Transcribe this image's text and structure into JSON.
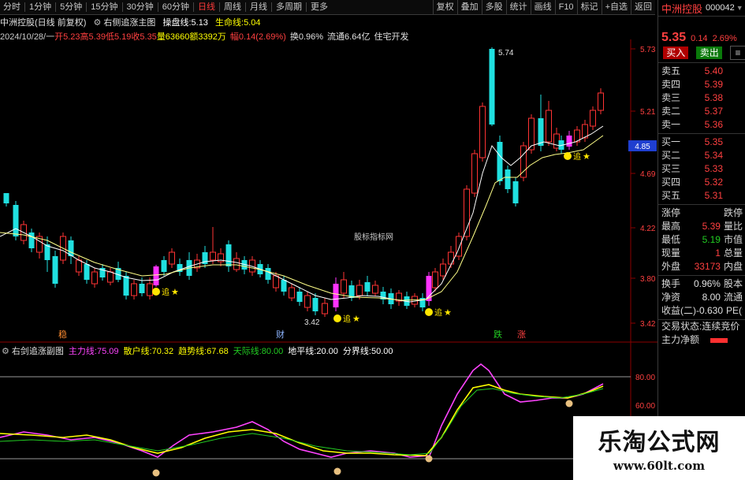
{
  "tabs": [
    {
      "label": "分时",
      "active": false
    },
    {
      "label": "1分钟",
      "active": false
    },
    {
      "label": "5分钟",
      "active": false
    },
    {
      "label": "15分钟",
      "active": false
    },
    {
      "label": "30分钟",
      "active": false
    },
    {
      "label": "60分钟",
      "active": false
    },
    {
      "label": "日线",
      "active": true
    },
    {
      "label": "周线",
      "active": false
    },
    {
      "label": "月线",
      "active": false
    },
    {
      "label": "多周期",
      "active": false
    },
    {
      "label": "更多",
      "active": false
    }
  ],
  "toolbar": [
    "复权",
    "叠加",
    "多股",
    "统计",
    "画线",
    "F10",
    "标记",
    "+自选",
    "返回"
  ],
  "info1": {
    "title": "中洲控股(日线 前复权)",
    "indicator": "右侧追涨主图",
    "pan_label": "操盘线:",
    "pan_value": "5.13",
    "life_label": "生命线:",
    "life_value": "5.04"
  },
  "info2": {
    "date": "2024/10/28/一",
    "open": "开5.23",
    "high": "高5.39",
    "low": "低5.19",
    "close": "收5.35",
    "vol": "量63660",
    "amount": "额3392万",
    "change": "幅0.14(2.69%)",
    "turnover": "换0.96%",
    "float": "流通6.64亿",
    "industry": "住宅开发"
  },
  "price_axis": [
    "5.73",
    "5.21",
    "4.69",
    "4.22",
    "3.80",
    "3.42"
  ],
  "current_price_tag": "4.85",
  "chart_center_label": "股标指标网",
  "peak_label": "5.74",
  "low_label": "3.42",
  "signal_text": "追",
  "period_markers": [
    "稳",
    "财",
    "跌",
    "涨"
  ],
  "lower_indicator": {
    "name": "右剑追涨副图",
    "lines": [
      {
        "label": "主力线:",
        "value": "75.09",
        "color": "#ff44ff"
      },
      {
        "label": "散户线:",
        "value": "70.32",
        "color": "#ffff00"
      },
      {
        "label": "趋势线:",
        "value": "67.68",
        "color": "#ffff00"
      },
      {
        "label": "天际线:",
        "value": "80.00",
        "color": "#22cc22"
      },
      {
        "label": "地平线:",
        "value": "20.00",
        "color": "#ffffff"
      },
      {
        "label": "分界线:",
        "value": "50.00",
        "color": "#ffffff"
      }
    ],
    "axis": [
      "80.00",
      "60.00"
    ]
  },
  "quote": {
    "name": "中洲控股",
    "code": "000042",
    "price": "5.35",
    "change": "0.14",
    "pct": "2.69%",
    "buy_btn": "买入",
    "sell_btn": "卖出",
    "asks": [
      {
        "label": "卖五",
        "price": "5.40"
      },
      {
        "label": "卖四",
        "price": "5.39"
      },
      {
        "label": "卖三",
        "price": "5.38"
      },
      {
        "label": "卖二",
        "price": "5.37"
      },
      {
        "label": "卖一",
        "price": "5.36"
      }
    ],
    "bids": [
      {
        "label": "买一",
        "price": "5.35"
      },
      {
        "label": "买二",
        "price": "5.34"
      },
      {
        "label": "买三",
        "price": "5.33"
      },
      {
        "label": "买四",
        "price": "5.32"
      },
      {
        "label": "买五",
        "price": "5.31"
      }
    ],
    "stats": [
      {
        "label": "涨停",
        "value": "",
        "side": "跌停"
      },
      {
        "label": "最高",
        "value": "5.39",
        "side": "量比"
      },
      {
        "label": "最低",
        "value": "5.19",
        "side": "市值"
      },
      {
        "label": "现量",
        "value": "1",
        "side": "总量"
      },
      {
        "label": "外盘",
        "value": "33173",
        "side": "内盘"
      }
    ],
    "stats2": [
      {
        "label": "换手",
        "value": "0.96%",
        "side": "股本"
      },
      {
        "label": "净资",
        "value": "8.00",
        "side": "流通"
      },
      {
        "label": "收益(二)",
        "value": "-0.630",
        "side": "PE(动)"
      }
    ],
    "status_label": "交易状态:",
    "status_value": "连续竞价",
    "net_label": "主力净额"
  },
  "watermark": {
    "title": "乐淘公式网",
    "url": "www.60lt.com"
  },
  "colors": {
    "up": "#ff3333",
    "down": "#20e0e0",
    "pink": "#ff33ff",
    "yellow": "#ffff00",
    "white": "#ffffff",
    "green": "#22cc22"
  }
}
